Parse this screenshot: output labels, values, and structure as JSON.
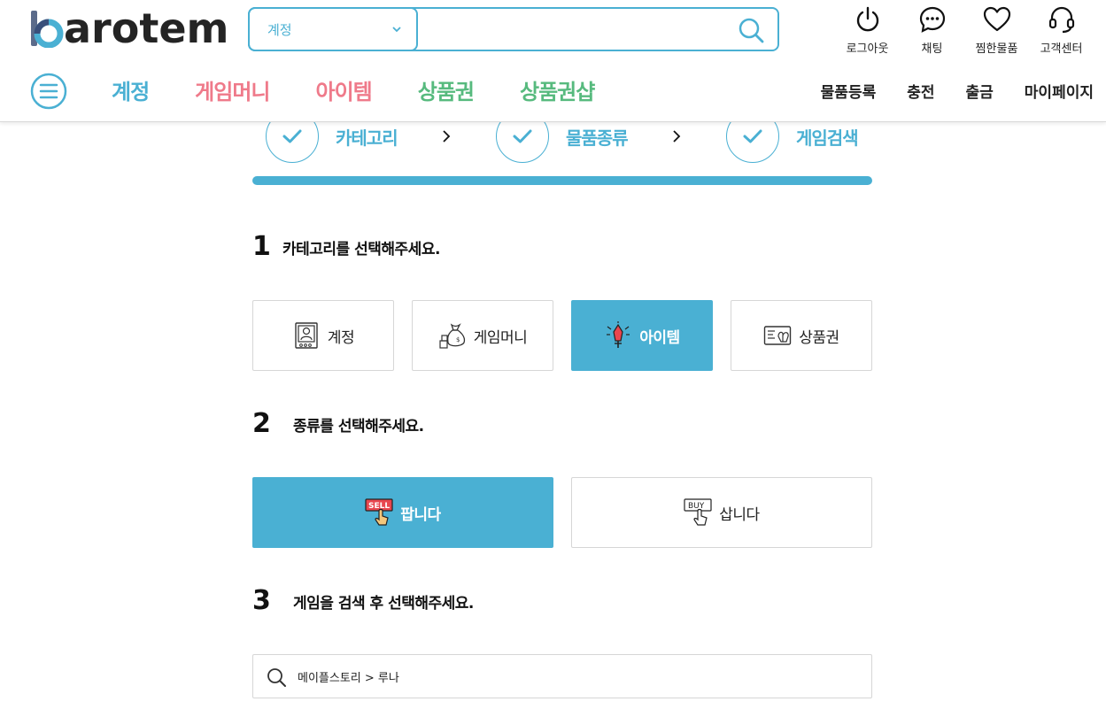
{
  "brand": {
    "logo_text": "arotem",
    "accent": "#4ab0d3"
  },
  "search": {
    "selected_category": "계정",
    "value": "",
    "placeholder": ""
  },
  "top_icons": [
    {
      "icon": "power-icon",
      "label": "로그아웃"
    },
    {
      "icon": "chat-icon",
      "label": "채팅"
    },
    {
      "icon": "heart-icon",
      "label": "찜한물품"
    },
    {
      "icon": "headset-icon",
      "label": "고객센터"
    }
  ],
  "main_nav": [
    {
      "label": "계정",
      "color": "#4ab0d3"
    },
    {
      "label": "게임머니",
      "color": "#ef7a8a"
    },
    {
      "label": "아이템",
      "color": "#ef7a8a"
    },
    {
      "label": "상품권",
      "color": "#57ba7e"
    },
    {
      "label": "상품권샵",
      "color": "#57ba7e"
    }
  ],
  "sub_nav": [
    "물품등록",
    "충전",
    "출금",
    "마이페이지"
  ],
  "steps": [
    "카테고리",
    "물품종류",
    "게임검색"
  ],
  "section1": {
    "number": "1",
    "title": "카테고리를 선택해주세요."
  },
  "categories": [
    {
      "label": "계정",
      "icon": "account-card-icon",
      "active": false
    },
    {
      "label": "게임머니",
      "icon": "money-bag-icon",
      "active": false
    },
    {
      "label": "아이템",
      "icon": "item-sword-icon",
      "active": true
    },
    {
      "label": "상품권",
      "icon": "gift-card-icon",
      "active": false
    }
  ],
  "section2": {
    "number": "2",
    "title": "종류를 선택해주세요."
  },
  "trade_types": [
    {
      "label": "팝니다",
      "icon": "sell-icon",
      "badge": "SELL",
      "active": true
    },
    {
      "label": "삽니다",
      "icon": "buy-icon",
      "badge": "BUY",
      "active": false
    }
  ],
  "section3": {
    "number": "3",
    "title": "게임을 검색 후 선택해주세요."
  },
  "game_search": {
    "value": "메이플스토리 > 루나"
  }
}
